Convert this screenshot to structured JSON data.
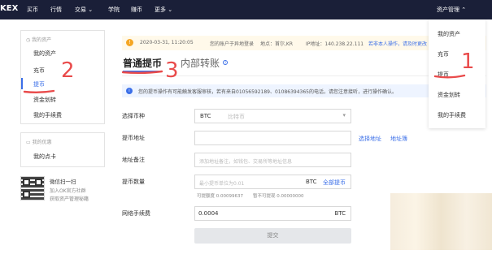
{
  "topnav": {
    "logo": "KEX",
    "items": [
      "买币",
      "行情",
      "交易 ⌄",
      "学院",
      "赚币",
      "更多 ⌄"
    ],
    "asset_menu": "资产管理 ⌃"
  },
  "sidebar": {
    "assets_title": "我的资产",
    "items": [
      "我的资产",
      "充币",
      "提币",
      "资金划转",
      "我的手续费"
    ],
    "offers_title": "我的优惠",
    "offer_items": [
      "我的点卡"
    ],
    "qr_title": "微信扫一扫",
    "qr_line1": "加入OK官方社群",
    "qr_line2": "获取资产管理秘籍"
  },
  "notice": {
    "time": "2020-03-31, 11:20:05",
    "text1": "您的账户于异地登录",
    "location": "地点：首尔,KR",
    "ip": "IP地址：140.238.22.111",
    "link": "若非本人操作，请及时更改"
  },
  "tabs": {
    "active": "普通提币",
    "inactive": "内部转账"
  },
  "info_text": "您的提币操作有可能触发客服审核，若有来自01056592189、01086394365的电话，请您注意接听，进行操作确认。",
  "form": {
    "coin_label": "选择币种",
    "coin_value": "BTC",
    "coin_placeholder": "比特币",
    "addr_label": "提币地址",
    "select_addr": "选择地址",
    "addr_book": "地址簿",
    "memo_label": "地址备注",
    "memo_placeholder": "添加地址备注，如钱包、交易所等地址信息",
    "amount_label": "提币数量",
    "amount_placeholder": "最小提币单位为0.01",
    "amount_unit": "BTC",
    "all_btn": "全部提币",
    "avail": "可提额度 0.00099637",
    "pending": "暂不可提现 0.00000000",
    "fee_label": "网络手续费",
    "fee_value": "0.0004",
    "fee_unit": "BTC",
    "submit": "提交"
  },
  "dropdown": [
    "我的资产",
    "充币",
    "提币",
    "资金划转",
    "我的手续费"
  ],
  "annotations": [
    "1",
    "2",
    "3"
  ]
}
